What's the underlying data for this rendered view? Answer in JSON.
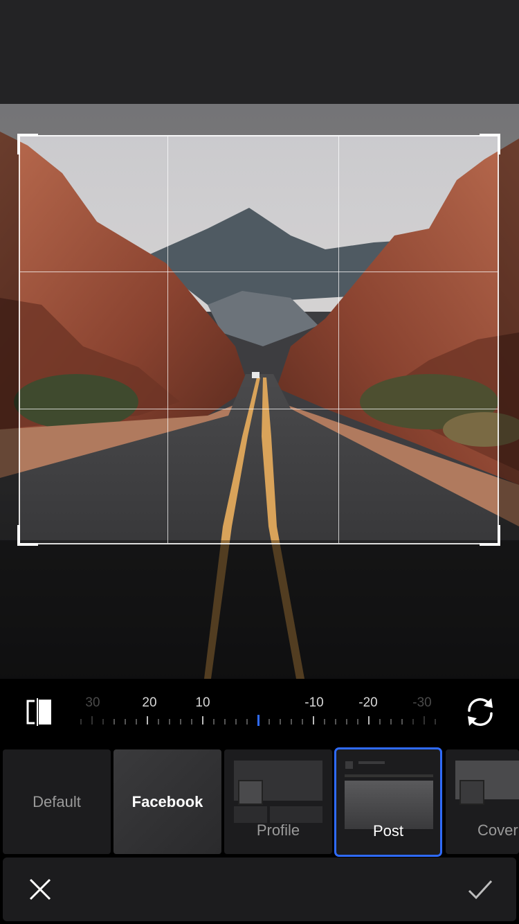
{
  "rotation_ruler": {
    "labels": [
      "30",
      "20",
      "10",
      "-10",
      "-20",
      "-30"
    ],
    "value": 0
  },
  "presets": [
    {
      "label": "Default"
    },
    {
      "label": "Facebook"
    },
    {
      "label": "Profile"
    },
    {
      "label": "Post"
    },
    {
      "label": "Cover"
    }
  ],
  "selected_preset": "Post",
  "icons": {
    "flip": "flip-icon",
    "rotate": "rotate-icon",
    "cancel": "close-icon",
    "confirm": "checkmark-icon"
  },
  "colors": {
    "accent": "#2f6bff",
    "background": "#000000",
    "panel": "#1c1c1e"
  }
}
